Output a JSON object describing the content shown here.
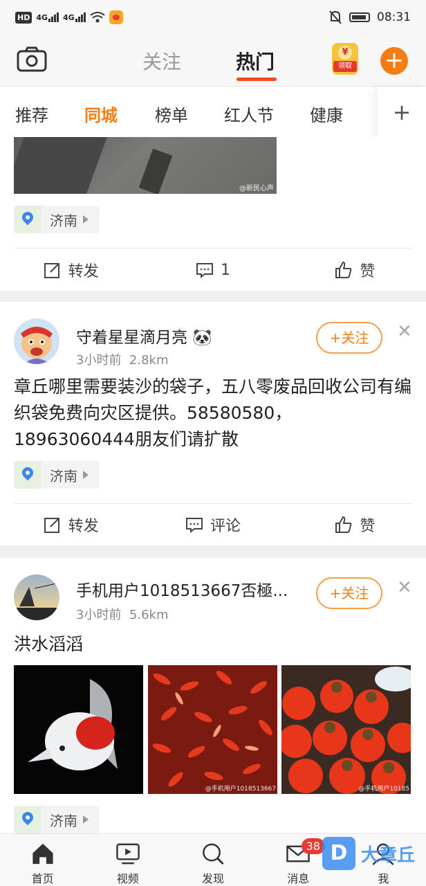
{
  "status": {
    "time": "08:31",
    "hd": "HD",
    "net1": "4G",
    "net2": "4G"
  },
  "header": {
    "tab_follow": "关注",
    "tab_hot": "热门",
    "redbag_label": "领取",
    "redbag_coin": "¥"
  },
  "channels": [
    "推荐",
    "同城",
    "榜单",
    "红人节",
    "健康"
  ],
  "active_channel": "同城",
  "post0": {
    "image_watermark": "@新民心声",
    "location": "济南",
    "repost": "转发",
    "comment": "1",
    "like": "赞"
  },
  "post1": {
    "user": "守着星星滴月亮",
    "time": "3小时前",
    "distance": "2.8km",
    "follow": "+关注",
    "text": "章丘哪里需要装沙的袋子，五八零废品回收公司有编织袋免费向灾区提供。58580580，18963060444朋友们请扩散",
    "location": "济南",
    "repost": "转发",
    "comment": "评论",
    "like": "赞"
  },
  "post2": {
    "user": "手机用户1018513667否極...",
    "time": "3小时前",
    "distance": "5.6km",
    "follow": "+关注",
    "text": "洪水滔滔",
    "img2_watermark": "@手机用户1018513667",
    "img3_watermark": "@手机用户10185",
    "location": "济南"
  },
  "nav": [
    {
      "label": "首页",
      "icon": "home-icon"
    },
    {
      "label": "视频",
      "icon": "video-icon"
    },
    {
      "label": "发现",
      "icon": "search-icon"
    },
    {
      "label": "消息",
      "icon": "mail-icon",
      "badge": "38"
    },
    {
      "label": "我",
      "icon": "profile-icon"
    }
  ],
  "watermark": {
    "logo": "D",
    "text": "大章丘"
  },
  "colors": {
    "accent": "#f57e14",
    "hot_underline": "#f04b1f",
    "badge": "#e83a2f"
  }
}
